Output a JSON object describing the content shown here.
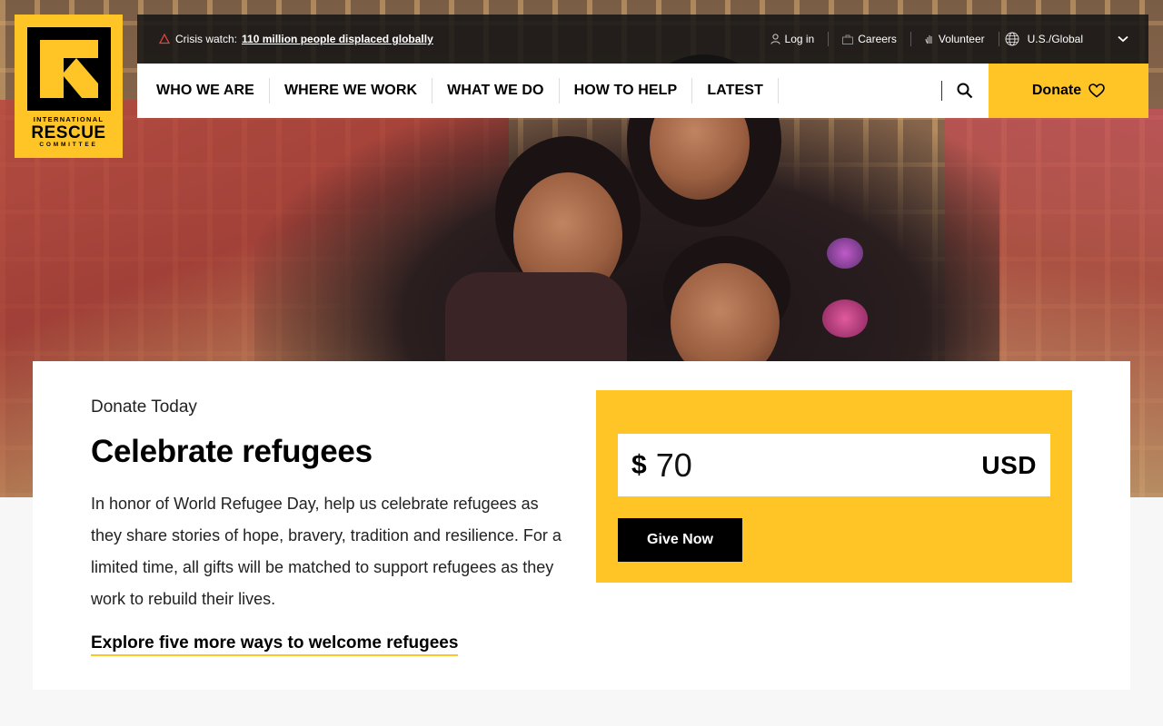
{
  "logo": {
    "line1": "INTERNATIONAL",
    "line2": "RESCUE",
    "line3": "COMMITTEE"
  },
  "topbar": {
    "crisis_label": "Crisis watch:",
    "crisis_link": "110 million people displaced globally",
    "login": "Log in",
    "careers": "Careers",
    "volunteer": "Volunteer",
    "region": "U.S./Global"
  },
  "nav": {
    "items": [
      {
        "label": "WHO WE ARE"
      },
      {
        "label": "WHERE WE WORK"
      },
      {
        "label": "WHAT WE DO"
      },
      {
        "label": "HOW TO HELP"
      },
      {
        "label": "LATEST"
      }
    ],
    "donate": "Donate"
  },
  "content": {
    "eyebrow": "Donate Today",
    "headline": "Celebrate refugees",
    "body": "In honor of World Refugee Day, help us celebrate refugees as they share stories of hope, bravery, tradition and resilience. For a limited time, all gifts will be matched to support refugees as they work to rebuild their lives.",
    "explore_link": "Explore five more ways to welcome refugees"
  },
  "donation": {
    "currency_symbol": "$",
    "amount": "70",
    "currency_code": "USD",
    "give_button": "Give Now"
  },
  "colors": {
    "brand_yellow": "#ffc527",
    "black": "#000000"
  }
}
